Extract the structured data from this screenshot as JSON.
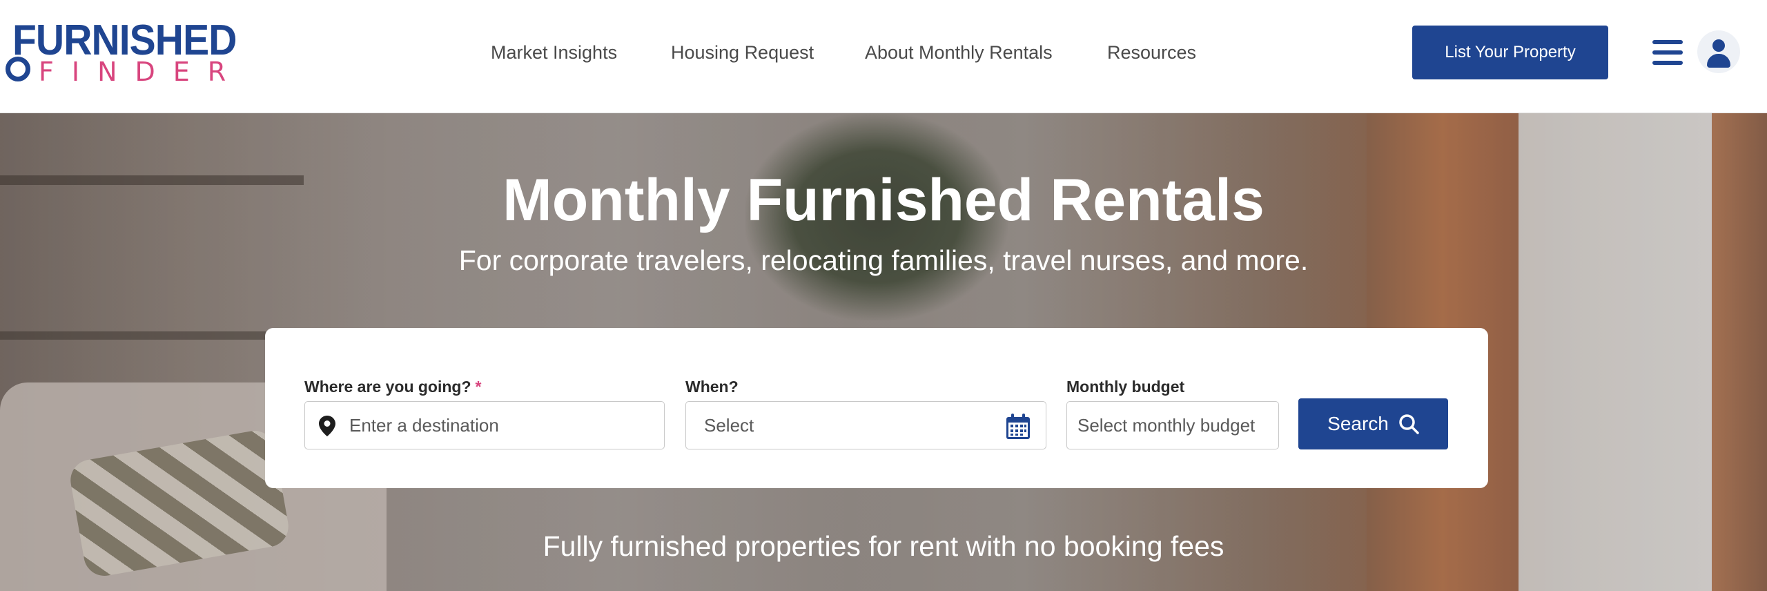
{
  "brand": {
    "name_top": "FURNISHED",
    "name_bottom": "FINDER",
    "primary_color": "#1f4591",
    "accent_color": "#d8457e"
  },
  "nav": {
    "items": [
      {
        "label": "Market Insights"
      },
      {
        "label": "Housing Request"
      },
      {
        "label": "About Monthly Rentals"
      },
      {
        "label": "Resources"
      }
    ],
    "list_property_label": "List Your Property",
    "menu_icon": "hamburger-icon",
    "account_icon": "user-icon"
  },
  "hero": {
    "title": "Monthly Furnished Rentals",
    "subtitle": "For corporate travelers, relocating families, travel nurses, and more.",
    "bottom_text": "Fully furnished properties for rent with no booking fees"
  },
  "search": {
    "destination": {
      "label": "Where are you going?",
      "required_mark": "*",
      "placeholder": "Enter a destination",
      "value": ""
    },
    "when": {
      "label": "When?",
      "placeholder": "Select",
      "value": ""
    },
    "budget": {
      "label": "Monthly budget",
      "placeholder": "Select monthly budget",
      "value": ""
    },
    "button_label": "Search"
  }
}
